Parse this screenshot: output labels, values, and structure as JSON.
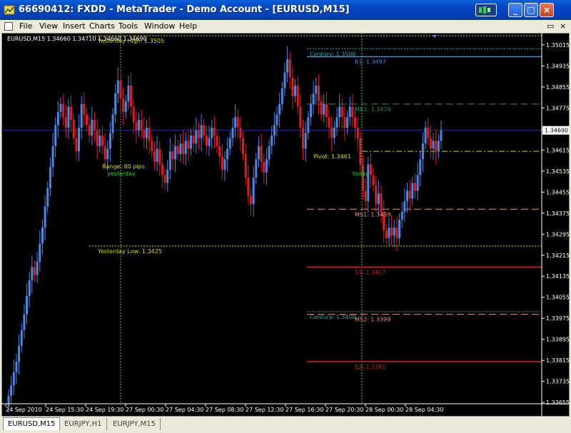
{
  "window": {
    "title": "66690412: FXDD - MetaTrader - Demo Account - [EURUSD,M15]",
    "minimize_glyph": "_",
    "maximize_glyph": "□",
    "close_glyph": "×"
  },
  "menu": {
    "items": [
      "File",
      "View",
      "Insert",
      "Charts",
      "Tools",
      "Window",
      "Help"
    ],
    "restore_glyph": "▭",
    "close_glyph": "×"
  },
  "tabs": [
    {
      "label": "EURUSD,M15",
      "active": true
    },
    {
      "label": "EURJPY,H1",
      "active": false
    },
    {
      "label": "EURJPY,M15",
      "active": false
    }
  ],
  "chart_data": {
    "type": "candlestick",
    "symbol": "EURUSD",
    "timeframe": "M15",
    "header": "EURUSD,M15  1.34660 1.34710 1.34660 1.34690",
    "current_price": "1.34690",
    "ylim": [
      1.3365,
      1.3505
    ],
    "y_ticks": [
      "1.35015",
      "1.34935",
      "1.34855",
      "1.34775",
      "1.34695",
      "1.34615",
      "1.34535",
      "1.34455",
      "1.34375",
      "1.34295",
      "1.34215",
      "1.34135",
      "1.34055",
      "1.33975",
      "1.33895",
      "1.33815",
      "1.33735",
      "1.33655"
    ],
    "x_ticks": [
      "24 Sep 2010",
      "24 Sep 15:30",
      "24 Sep 19:30",
      "27 Sep 00:30",
      "27 Sep 04:30",
      "27 Sep 08:30",
      "27 Sep 12:30",
      "27 Sep 16:30",
      "27 Sep 20:30",
      "28 Sep 00:30",
      "28 Sep 04:30"
    ],
    "levels": [
      {
        "label": "Yesterday High:  1.3505",
        "price": 1.3505,
        "color": "#d8d800",
        "style": "dotted",
        "from": "yesterday"
      },
      {
        "label": "Century:  1.3500",
        "price": 1.35,
        "color": "#2e9fa0",
        "style": "dotted",
        "from": "today"
      },
      {
        "label": "R1:  1.3497",
        "price": 1.3497,
        "color": "#4a88e8",
        "style": "solid",
        "from": "today"
      },
      {
        "label": "MR1:  1.3479",
        "price": 1.3479,
        "color": "#2e8b57",
        "style": "dashed",
        "from": "today"
      },
      {
        "label": "Pivot:  1.3461",
        "price": 1.3461,
        "color": "#d8d800",
        "style": "dashdot",
        "from": "today"
      },
      {
        "label": "MS1:  1.3439",
        "price": 1.3439,
        "color": "#e9967a",
        "style": "dashed",
        "from": "today"
      },
      {
        "label": "Yesterday Low:  1.3425",
        "price": 1.3425,
        "color": "#d8d800",
        "style": "dotted",
        "from": "yesterday"
      },
      {
        "label": "S1:  1.3417",
        "price": 1.3417,
        "color": "#d82020",
        "style": "solid",
        "from": "today"
      },
      {
        "label": "Century:  1.3400",
        "price": 1.34,
        "color": "#2e9fa0",
        "style": "dotted",
        "from": "today"
      },
      {
        "label": "MS2:  1.3399",
        "price": 1.3399,
        "color": "#e9967a",
        "style": "dashed",
        "from": "today"
      },
      {
        "label": "S2:  1.3381",
        "price": 1.3381,
        "color": "#d82020",
        "style": "solid",
        "from": "today"
      }
    ],
    "annotations": [
      {
        "text": "Range:  80 pips",
        "color": "#d8d800"
      },
      {
        "text": "yesterday",
        "color": "#2bd52b"
      },
      {
        "text": "today",
        "color": "#2bd52b"
      }
    ],
    "day_separators": [
      "27 Sep 00:00",
      "28 Sep 00:00"
    ],
    "bull_color": "#4a88e8",
    "bear_color": "#d82020",
    "background": "#000000",
    "price_line_color": "#2030a0",
    "separator_color": "#3ecf3e",
    "closes": [
      1.3368,
      1.3372,
      1.3377,
      1.3381,
      1.3387,
      1.3393,
      1.3399,
      1.3406,
      1.3412,
      1.3417,
      1.3414,
      1.3419,
      1.3426,
      1.3432,
      1.344,
      1.3447,
      1.3455,
      1.3463,
      1.3471,
      1.3476,
      1.3479,
      1.3474,
      1.347,
      1.3478,
      1.3473,
      1.3466,
      1.3461,
      1.347,
      1.3479,
      1.3475,
      1.3471,
      1.3467,
      1.3473,
      1.3469,
      1.3463,
      1.3467,
      1.3463,
      1.3458,
      1.3462,
      1.3468,
      1.3475,
      1.3483,
      1.3488,
      1.3481,
      1.3476,
      1.348,
      1.3486,
      1.3478,
      1.3472,
      1.3469,
      1.3473,
      1.3469,
      1.3466,
      1.347,
      1.3465,
      1.3461,
      1.3457,
      1.3462,
      1.3456,
      1.3452,
      1.3449,
      1.3454,
      1.3461,
      1.3458,
      1.3463,
      1.346,
      1.3464,
      1.346,
      1.3465,
      1.3462,
      1.3467,
      1.3464,
      1.3469,
      1.3466,
      1.3471,
      1.3467,
      1.3463,
      1.3466,
      1.347,
      1.3467,
      1.3463,
      1.3459,
      1.3454,
      1.3458,
      1.3462,
      1.3466,
      1.347,
      1.3474,
      1.347,
      1.3466,
      1.346,
      1.3451,
      1.3444,
      1.3441,
      1.3451,
      1.3458,
      1.3463,
      1.3457,
      1.3453,
      1.3458,
      1.3463,
      1.3467,
      1.3471,
      1.3475,
      1.3479,
      1.3485,
      1.3491,
      1.3496,
      1.3489,
      1.3482,
      1.3486,
      1.3478,
      1.347,
      1.3462,
      1.3468,
      1.3474,
      1.3479,
      1.3483,
      1.3486,
      1.348,
      1.3475,
      1.3479,
      1.3474,
      1.347,
      1.3466,
      1.347,
      1.3474,
      1.3478,
      1.3474,
      1.347,
      1.3474,
      1.3478,
      1.3474,
      1.347,
      1.3466,
      1.3456,
      1.3446,
      1.3442,
      1.3456,
      1.3452,
      1.3448,
      1.3441,
      1.3445,
      1.3438,
      1.3431,
      1.3428,
      1.3432,
      1.3429,
      1.3432,
      1.3428,
      1.3435,
      1.3438,
      1.3442,
      1.3446,
      1.3443,
      1.3449,
      1.3446,
      1.3452,
      1.3458,
      1.3464,
      1.347,
      1.3466,
      1.3462,
      1.3465,
      1.3461,
      1.3465,
      1.3469
    ]
  }
}
